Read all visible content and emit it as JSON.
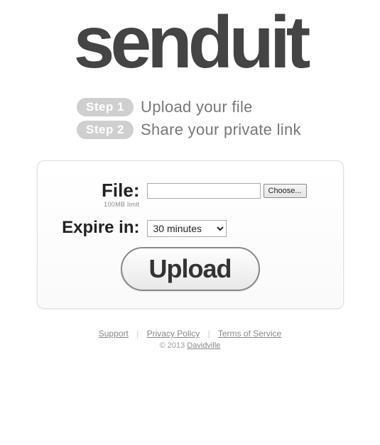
{
  "logo": "senduit",
  "steps": [
    {
      "badge": "Step 1",
      "text": "Upload your file"
    },
    {
      "badge": "Step 2",
      "text": "Share your private link"
    }
  ],
  "form": {
    "file_label": "File:",
    "file_limit": "100MB limit",
    "choose_label": "Choose...",
    "expire_label": "Expire in:",
    "expire_value": "30 minutes",
    "upload_label": "Upload"
  },
  "footer": {
    "links": {
      "support": "Support",
      "privacy": "Privacy Policy",
      "terms": "Terms of Service"
    },
    "separator": "|",
    "copyright_prefix": "© 2013 ",
    "company": "Davidville"
  }
}
